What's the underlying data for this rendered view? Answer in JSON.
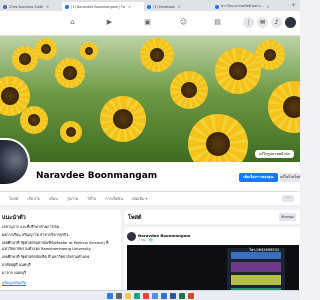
{
  "browser": {
    "tabs": [
      {
        "label": "Ches Business Suite",
        "active": false
      },
      {
        "label": "(1) Naravdee Boonmangam | Fa",
        "active": true
      },
      {
        "label": "(1) Facebook",
        "active": false
      },
      {
        "label": "ขาวไหนนะเรพอร์ตตัวอย่าง...",
        "active": false
      }
    ],
    "new_tab": "+"
  },
  "fb_nav": {
    "icons": [
      "home-icon",
      "video-icon",
      "marketplace-icon",
      "groups-icon",
      "gaming-icon"
    ],
    "right_icons": [
      "menu-icon",
      "messenger-icon",
      "bell-icon",
      "account-icon"
    ]
  },
  "cover": {
    "edit_label": "แก้ไขรูปภาพหน้าปก"
  },
  "profile": {
    "name": "Naravdee Boonmangam",
    "story_button": "เพิ่มเรื่องราวของคุณ",
    "edit_button": "แก้ไขโปรไฟล์",
    "tabs": [
      "โพสต์",
      "เกี่ยวกับ",
      "เพื่อน",
      "รูปภาพ",
      "วิดีโอ",
      "การเช็คอิน",
      "เพิ่มเติม ▾"
    ],
    "more_button": "···"
  },
  "intro": {
    "title": "แนะนำตัว",
    "lines": [
      "เลขานุการ และที่ปรึกษาด้านการเงิน",
      "ผลการเรียน ปริญญาโท สาขาบริหารธุรกิจ",
      "เคยศึกษาที่ รัฐศาสตรมหาบัณฑิต(Master of Political Science) ที่",
      "มหาวิทยาลัยรามคำแหง Ramkhamhaeng University",
      "เคยศึกษาที่ รัฐศาสตรบัณฑิต ที่ มหาวิทยาลัยรามคำแหง",
      "อาศัยอยู่ที่ นนทบุรี",
      "มาจาก นนทบุรี"
    ],
    "link": "ดูข้อมูลเพิ่มเติม"
  },
  "posts": {
    "title": "โพสต์",
    "filter_button": "ตัวกรอง",
    "post": {
      "author": "Naravdee Boonmangam",
      "time": "7 ชม. · 🌐",
      "phone": "โทร.0842698532"
    }
  },
  "taskbar": {
    "icons": [
      "windows-icon",
      "search-icon",
      "file-explorer-icon",
      "edge-icon",
      "chrome-icon",
      "store-icon",
      "mail-icon",
      "word-icon",
      "excel-icon",
      "powerpoint-icon"
    ]
  },
  "colors": {
    "fb_blue": "#1877f2",
    "background": "#f0f2f5",
    "sunflower_yellow": "#f6c21a"
  }
}
